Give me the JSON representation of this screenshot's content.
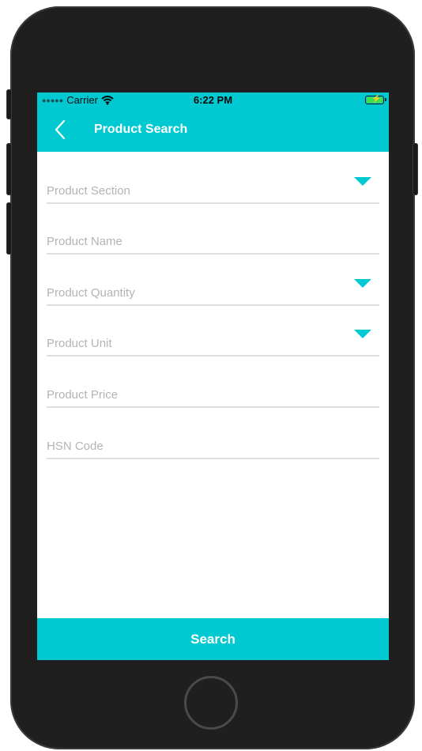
{
  "status_bar": {
    "carrier": "Carrier",
    "signal_icon": "signal-dots-icon",
    "wifi_icon": "wifi-icon",
    "time": "6:22 PM",
    "battery_icon": "battery-charging-icon"
  },
  "nav": {
    "back_icon": "chevron-left-icon",
    "title": "Product Search"
  },
  "form": {
    "fields": [
      {
        "placeholder": "Product Section",
        "value": "",
        "type": "dropdown"
      },
      {
        "placeholder": "Product Name",
        "value": "",
        "type": "text"
      },
      {
        "placeholder": "Product Quantity",
        "value": "",
        "type": "dropdown"
      },
      {
        "placeholder": "Product Unit",
        "value": "",
        "type": "dropdown"
      },
      {
        "placeholder": "Product Price",
        "value": "",
        "type": "text"
      },
      {
        "placeholder": "HSN Code",
        "value": "",
        "type": "text"
      }
    ]
  },
  "actions": {
    "search_label": "Search"
  },
  "colors": {
    "accent": "#00c9d1",
    "divider": "#dedede",
    "placeholder": "#b4b4b4",
    "device_body": "#1f1f1f"
  }
}
